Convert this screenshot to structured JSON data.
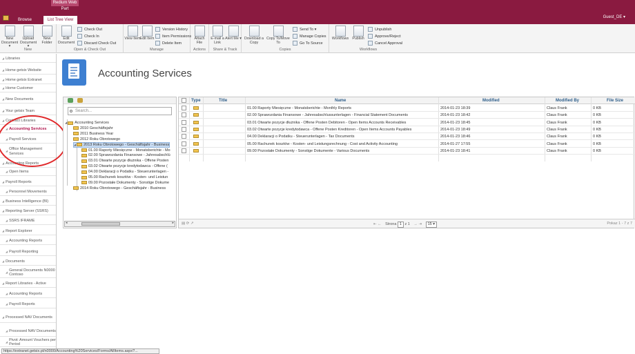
{
  "app": {
    "context_tab": "Redium Web Part",
    "tabs": [
      "Browse",
      "List Tree View"
    ],
    "user": "Guest_DE ▾"
  },
  "ribbon": {
    "groups": [
      "New",
      "Open & Check Out",
      "Manage",
      "Actions",
      "Share & Track",
      "Copies",
      "Workflows"
    ],
    "new": {
      "new_document": "New Document ▾",
      "upload_document": "Upload Document ▾",
      "new_folder": "New Folder"
    },
    "open": {
      "edit_document": "Edit Document",
      "check_out": "Check Out",
      "check_in": "Check In",
      "discard_check_out": "Discard Check Out"
    },
    "manage": {
      "view_item": "View Item",
      "edit_item": "Edit Item",
      "version_history": "Version History",
      "item_permissions": "Item Permissions",
      "delete_item": "Delete Item"
    },
    "actions": {
      "attach_file": "Attach File"
    },
    "share": {
      "email_link": "E-mail a Link",
      "alert_me": "Alert Me ▾"
    },
    "copies": {
      "download_copy": "Download a Copy",
      "copy_to_move_to": "Copy To/Move To",
      "send_to": "Send To ▾",
      "manage_copies": "Manage Copies",
      "go_to_source": "Go To Source"
    },
    "workflows": {
      "workflows": "Workflows",
      "publish": "Publish",
      "unpublish": "Unpublish",
      "approve_reject": "Approve/Reject",
      "cancel_approval": "Cancel Approval"
    }
  },
  "left_nav": [
    {
      "label": "Libraries",
      "sub": false,
      "active": false
    },
    {
      "label": "Home getsix Website",
      "sub": false,
      "active": false
    },
    {
      "label": "Home getsix Extranet",
      "sub": false,
      "active": false
    },
    {
      "label": "Home Customer",
      "sub": false,
      "active": false
    },
    {
      "label": "New Documents",
      "sub": false,
      "active": false
    },
    {
      "label": "Your getsix Team",
      "sub": false,
      "active": false
    },
    {
      "label": "Contract Libraries",
      "sub": false,
      "active": false
    },
    {
      "label": "Accounting Services",
      "sub": true,
      "active": true
    },
    {
      "label": "Payroll Services",
      "sub": true,
      "active": false
    },
    {
      "label": "Office Management Services",
      "sub": true,
      "active": false
    },
    {
      "label": "Accounting Reports",
      "sub": false,
      "active": false
    },
    {
      "label": "Open Items",
      "sub": true,
      "active": false
    },
    {
      "label": "Payroll Reports",
      "sub": false,
      "active": false
    },
    {
      "label": "Personnel Movements",
      "sub": true,
      "active": false
    },
    {
      "label": "Business Intelligence (BI)",
      "sub": false,
      "active": false
    },
    {
      "label": "Reporting Server (SSRS)",
      "sub": false,
      "active": false
    },
    {
      "label": "SSRS IFRAME",
      "sub": true,
      "active": false
    },
    {
      "label": "Report Explorer",
      "sub": false,
      "active": false
    },
    {
      "label": "Accounting Reports",
      "sub": true,
      "active": false
    },
    {
      "label": "Payroll Reporting",
      "sub": true,
      "active": false
    },
    {
      "label": "Documents",
      "sub": false,
      "active": false
    },
    {
      "label": "General Documents N0000 Contoso",
      "sub": true,
      "active": false
    },
    {
      "label": "Report Libraries - Active",
      "sub": false,
      "active": false
    },
    {
      "label": "Accounting Reports",
      "sub": true,
      "active": false
    },
    {
      "label": "Payroll Reports",
      "sub": true,
      "active": false
    },
    {
      "label": "Processed NAV Documents",
      "sub": false,
      "active": false
    },
    {
      "label": "Processed NAV Documents",
      "sub": true,
      "active": false
    },
    {
      "label": "Pivot: Amount Vouchers per Period",
      "sub": true,
      "active": false
    }
  ],
  "page": {
    "title": "Accounting Services"
  },
  "tree": {
    "search_placeholder": "Search...",
    "items": [
      {
        "label": "Accounting Services",
        "level": 0,
        "expander": "◢",
        "selected": false
      },
      {
        "label": "2010 Geschäftsjahr",
        "level": 1,
        "expander": "",
        "selected": false
      },
      {
        "label": "2011 Business Year",
        "level": 1,
        "expander": "",
        "selected": false
      },
      {
        "label": "2012 Roku Obrotowego",
        "level": 1,
        "expander": "",
        "selected": false
      },
      {
        "label": "2013 Roku Obrotowego - Geschäftsjahr - Business",
        "level": 1,
        "expander": "◢",
        "selected": true
      },
      {
        "label": "01.00 Raporty Miesięczne - Monatsberichte - Mo",
        "level": 2,
        "expander": "",
        "selected": false
      },
      {
        "label": "02.00 Sprawozdania Finansowe - Jahresabschlü",
        "level": 2,
        "expander": "",
        "selected": false
      },
      {
        "label": "03.01 Otwarte pozycje dłużnika - Offene Posten",
        "level": 2,
        "expander": "",
        "selected": false
      },
      {
        "label": "03.02 Otwarte pozycje kredytodawca - Offene (",
        "level": 2,
        "expander": "",
        "selected": false
      },
      {
        "label": "04.00 Deklaracji o Podatku - Steuerunterlagen -",
        "level": 2,
        "expander": "",
        "selected": false
      },
      {
        "label": "05.00 Rachunek kosztów - Kosten- und Leistun",
        "level": 2,
        "expander": "",
        "selected": false
      },
      {
        "label": "09.00 Pozostałe Dokumenty - Sonstige Dokume",
        "level": 2,
        "expander": "",
        "selected": false
      },
      {
        "label": "2014 Roku Obrotowego - Geschäftsjahr - Business",
        "level": 1,
        "expander": "",
        "selected": false
      }
    ]
  },
  "grid": {
    "columns": {
      "type": "Type",
      "title": "Title",
      "name": "Name",
      "modified": "Modified",
      "modified_by": "Modified By",
      "file_size": "File Size"
    },
    "rows": [
      {
        "title": "",
        "name": "01.00 Raporty Miesięczne - Monatsberichte - Monthly Reports",
        "modified": "2014-01-23 18:39",
        "modified_by": "Claus Frank",
        "file_size": "0 KB"
      },
      {
        "title": "",
        "name": "02.00 Sprawozdania Finansowe - Jahresabschlussunterlagen - Financial Statement Documents",
        "modified": "2014-01-23 18:42",
        "modified_by": "Claus Frank",
        "file_size": "0 KB"
      },
      {
        "title": "",
        "name": "03.01 Otwarte pozycje dłużnika - Offene Posten Debitoren - Open Items Accounts Receivables",
        "modified": "2014-01-23 18:45",
        "modified_by": "Claus Frank",
        "file_size": "0 KB"
      },
      {
        "title": "",
        "name": "03.02 Otwarte pozycje kredytodawca - Offene Posten Kreditoren - Open Items Accounts Payables",
        "modified": "2014-01-23 18:49",
        "modified_by": "Claus Frank",
        "file_size": "0 KB"
      },
      {
        "title": "",
        "name": "04.00 Deklaracji o Podatku - Steuerunterlagen - Tax Documents",
        "modified": "2014-01-23 18:46",
        "modified_by": "Claus Frank",
        "file_size": "0 KB"
      },
      {
        "title": "",
        "name": "05.00 Rachunek kosztów - Kosten- und Leistungsrechnung - Cost and Activity Accounting",
        "modified": "2014-01-27 17:55",
        "modified_by": "Claus Frank",
        "file_size": "0 KB"
      },
      {
        "title": "",
        "name": "09.00 Pozostałe Dokumenty - Sonstige Dokumente - Various Documents",
        "modified": "2014-01-23 18:41",
        "modified_by": "Claus Frank",
        "file_size": "0 KB"
      }
    ],
    "footer": {
      "pager_nav": "⇤ ←",
      "page_label": "Strona",
      "page_value": "1",
      "of_label": "z 1",
      "pager_nav_end": "→ ⇥",
      "page_size": "15",
      "summary": "Pokaz 1 - 7 z 7",
      "tool_icons": "▤ ⟳ ↗"
    }
  },
  "status_bar": {
    "url": "https://extranet.getsix.pl/n0000/Accounting%20Services/Forms/AllItems.aspx?..."
  },
  "colors": {
    "topbar": "#8a1a40",
    "accent_active": "#b0144c",
    "highlight_circle": "#e0282a",
    "tree_selected": "#c9dcf2"
  }
}
